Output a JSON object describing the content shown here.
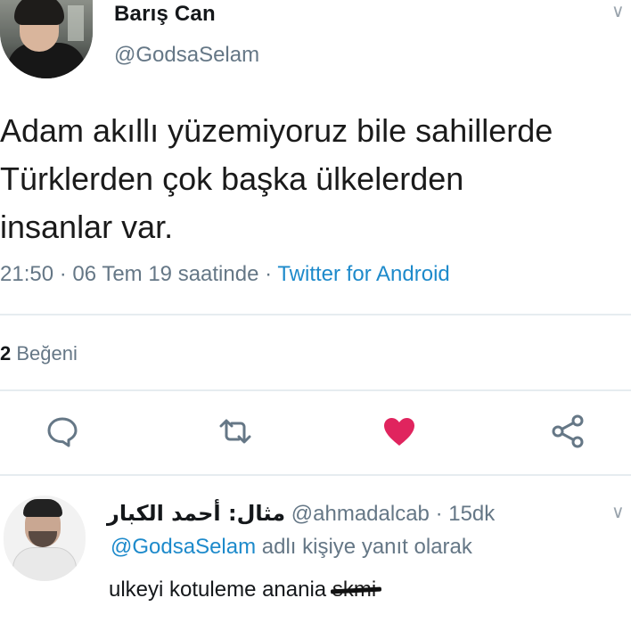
{
  "tweet": {
    "author_name": "Barış Can",
    "author_handle": "@GodsaSelam",
    "text": "Adam akıllı yüzemiyoruz bile sahillerde Türklerden çok başka ülkelerden insanlar var.",
    "time": "21:50 · 06 Tem 19 saatinde · ",
    "client": "Twitter for Android",
    "likes_count": "2",
    "likes_label": " Beğeni"
  },
  "actions": [
    {
      "icon": "reply-icon"
    },
    {
      "icon": "retweet-icon"
    },
    {
      "icon": "heart-icon",
      "color": "#e0245e",
      "active": true
    },
    {
      "icon": "share-icon"
    }
  ],
  "reply": {
    "display_name": "مثال: أحمد الكبار",
    "handle": " @ahmadalcab · 15dk",
    "replying_to_mention": "@GodsaSelam",
    "replying_to_suffix": " adlı kişiye yanıt olarak",
    "text": "ulkeyi kotuleme anania ",
    "scribbled_text": "skmi"
  },
  "icons": {
    "chevron": "chevron-down-icon"
  },
  "colors": {
    "link": "#1d8acb",
    "muted": "#657786",
    "like": "#e0245e",
    "divider": "#e6ecf0"
  }
}
